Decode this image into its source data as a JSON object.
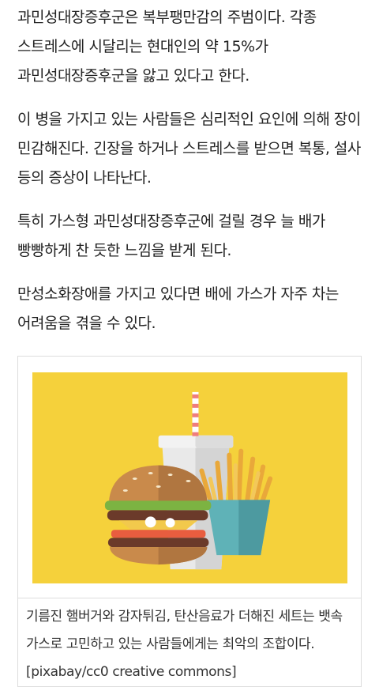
{
  "article": {
    "paragraphs": [
      "과민성대장증후군은 복부팽만감의 주범이다. 각종 스트레스에 시달리는 현대인의 약 15%가 과민성대장증후군을 앓고 있다고 한다.",
      "이 병을 가지고 있는 사람들은 심리적인 요인에 의해 장이 민감해진다. 긴장을 하거나 스트레스를 받으면 복통, 설사 등의 증상이 나타난다.",
      "특히 가스형 과민성대장증후군에 걸릴 경우 늘 배가 빵빵하게 찬 듯한 느낌을 받게 된다.",
      "만성소화장애를 가지고 있다면 배에 가스가 자주 차는 어려움을 겪을 수 있다."
    ]
  },
  "figure": {
    "image_icon": "hamburger-fries-soda-illustration",
    "caption": "기름진 햄버거와 감자튀김, 탄산음료가 더해진 세트는 뱃속 가스로 고민하고 있는 사람들에게는 최악의 조합이다. [pixabay/cc0 creative commons]"
  },
  "colors": {
    "background": "#ffffff",
    "text": "#222222",
    "illustration_bg": "#f5d13b",
    "border": "#dddddd"
  }
}
